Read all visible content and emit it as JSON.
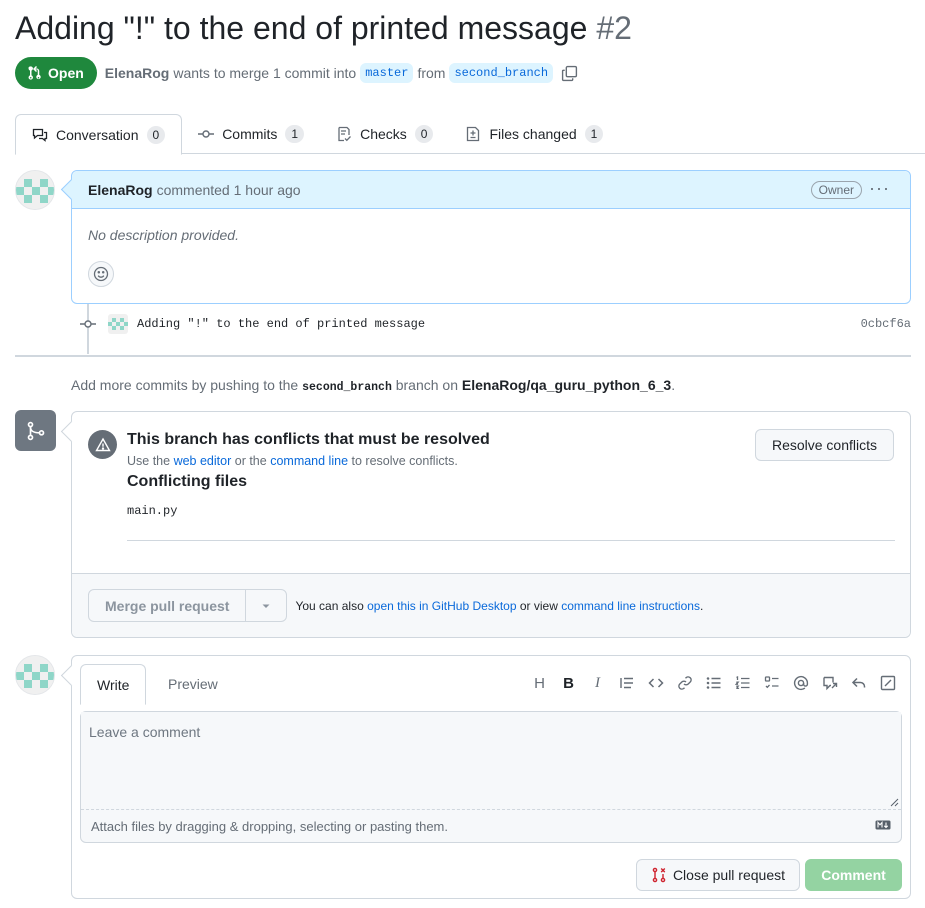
{
  "pr": {
    "title": "Adding \"!\" to the end of printed message",
    "number": "#2",
    "state_label": "Open",
    "author": "ElenaRog",
    "merge_text": "wants to merge 1 commit into",
    "base_branch": "master",
    "from_text": "from",
    "head_branch": "second_branch"
  },
  "tabs": [
    {
      "label": "Conversation",
      "count": "0",
      "icon": "comment-discussion-icon"
    },
    {
      "label": "Commits",
      "count": "1",
      "icon": "git-commit-icon"
    },
    {
      "label": "Checks",
      "count": "0",
      "icon": "checklist-icon"
    },
    {
      "label": "Files changed",
      "count": "1",
      "icon": "file-diff-icon"
    }
  ],
  "comment": {
    "author": "ElenaRog",
    "action": "commented 1 hour ago",
    "role": "Owner",
    "body": "No description provided."
  },
  "commit": {
    "message": "Adding \"!\" to the end of printed message",
    "sha": "0cbcf6a"
  },
  "hint": {
    "prefix": "Add more commits by pushing to the",
    "branch": "second_branch",
    "middle": "branch on",
    "repo": "ElenaRog/qa_guru_python_6_3",
    "suffix": "."
  },
  "merge": {
    "conflict_title": "This branch has conflicts that must be resolved",
    "use_the": "Use the",
    "web_editor": "web editor",
    "or_the": "or the",
    "command_line": "command line",
    "to_resolve": "to resolve conflicts.",
    "resolve_button": "Resolve conflicts",
    "files_title": "Conflicting files",
    "files": [
      "main.py"
    ],
    "merge_button": "Merge pull request",
    "also_text": "You can also",
    "desktop_link": "open this in GitHub Desktop",
    "or_view": "or view",
    "instructions_link": "command line instructions",
    "period": "."
  },
  "new_comment": {
    "write_tab": "Write",
    "preview_tab": "Preview",
    "placeholder": "Leave a comment",
    "attach_text": "Attach files by dragging & dropping, selecting or pasting them.",
    "close_button": "Close pull request",
    "comment_button": "Comment",
    "toolbar": [
      "H",
      "B",
      "I"
    ]
  },
  "colors": {
    "open_green": "#1f883d",
    "link_blue": "#0969da",
    "comment_header": "#ddf4ff",
    "close_red": "#cf222e"
  }
}
